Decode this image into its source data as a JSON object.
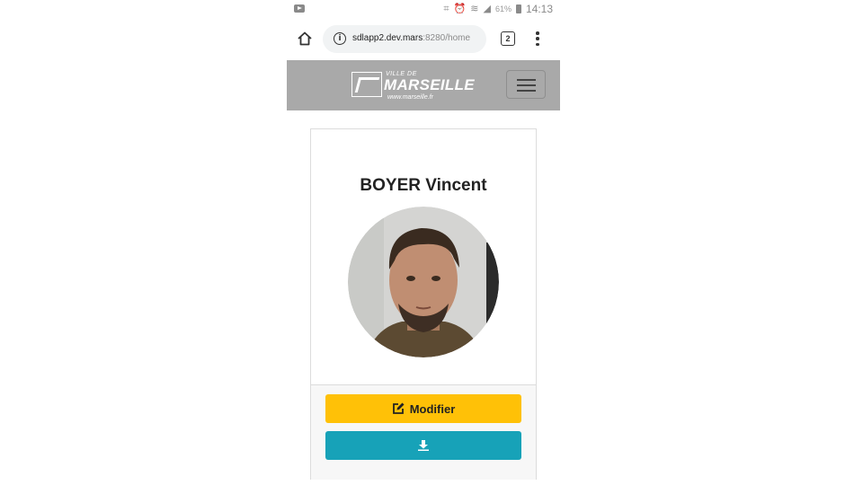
{
  "status_bar": {
    "battery_percent": "61%",
    "time": "14:13"
  },
  "browser": {
    "url_host": "sdlapp2.dev.mars",
    "url_path": ":8280/home",
    "tab_count": "2"
  },
  "header": {
    "logo_top": "VILLE DE",
    "logo_name": "MARSEILLE",
    "logo_url": "www.marseille.fr"
  },
  "profile": {
    "name": "BOYER Vincent",
    "modify_label": "Modifier"
  },
  "colors": {
    "header_bg": "#a9a9a9",
    "modify_button": "#ffc107",
    "download_button": "#17a2b8"
  },
  "icons": {
    "home": "home-icon",
    "info": "info-icon",
    "tabs": "tabs-icon",
    "menu": "more-vert-icon",
    "hamburger": "hamburger-menu-icon",
    "edit": "edit-icon",
    "download": "download-icon"
  }
}
